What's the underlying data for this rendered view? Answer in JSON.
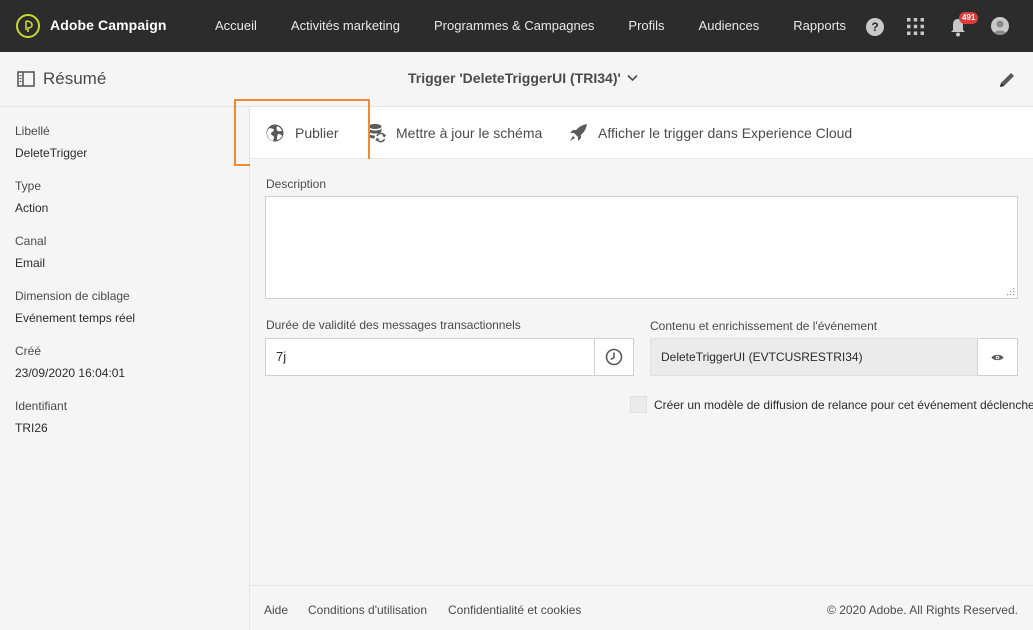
{
  "topbar": {
    "brand": "Adobe Campaign",
    "nav": [
      "Accueil",
      "Activités marketing",
      "Programmes & Campagnes",
      "Profils",
      "Audiences",
      "Rapports"
    ],
    "help_glyph": "?",
    "notifications_count": "491",
    "icons": [
      "adobe-campaign-logo-icon",
      "help-icon",
      "apps-grid-icon",
      "bell-icon",
      "user-avatar-icon"
    ]
  },
  "subheader": {
    "title": "Résumé",
    "trigger_title": "Trigger 'DeleteTriggerUI (TRI34)'",
    "icons": [
      "summary-panel-icon",
      "chevron-down-icon",
      "pencil-icon"
    ]
  },
  "sidebar": {
    "fields": [
      {
        "label": "Libellé",
        "value": "DeleteTrigger"
      },
      {
        "label": "Type",
        "value": "Action"
      },
      {
        "label": "Canal",
        "value": "Email"
      },
      {
        "label": "Dimension de ciblage",
        "value": "Evénement temps réel"
      },
      {
        "label": "Créé",
        "value": "23/09/2020 16:04:01"
      },
      {
        "label": "Identifiant",
        "value": "TRI26"
      }
    ]
  },
  "actions": {
    "publish": "Publier",
    "update_schema": "Mettre à jour le schéma",
    "show_trigger": "Afficher le trigger dans Experience Cloud",
    "icons": [
      "globe-icon",
      "database-refresh-icon",
      "rocket-icon"
    ],
    "highlight_color": "#f28b30"
  },
  "form": {
    "description_label": "Description",
    "description_value": "",
    "duration_label": "Durée de validité des messages transactionnels",
    "duration_value": "7j",
    "content_label": "Contenu et enrichissement de l'événement",
    "content_value": "DeleteTriggerUI (EVTCUSRESTRI34)",
    "checkbox_label": "Créer un modèle de diffusion de relance pour cet événement déclencheur",
    "checkbox_checked": false,
    "icons": [
      "clock-icon",
      "eye-icon"
    ]
  },
  "footer": {
    "help": "Aide",
    "terms": "Conditions d'utilisation",
    "privacy": "Confidentialité et cookies",
    "copyright": "© 2020 Adobe. All Rights Reserved."
  }
}
